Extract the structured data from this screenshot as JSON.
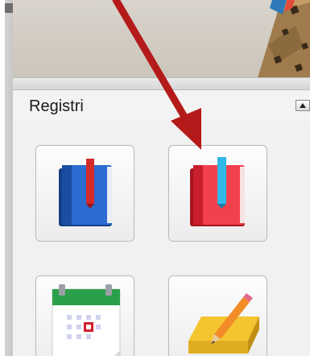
{
  "panel": {
    "title": "Registri"
  },
  "tiles": [
    {
      "icon": "blue-book-icon"
    },
    {
      "icon": "red-book-icon"
    },
    {
      "icon": "calendar-icon"
    },
    {
      "icon": "notepad-pencil-icon"
    }
  ],
  "colors": {
    "arrow": "#b51a1a",
    "blue_book": "#1f5bb8",
    "red_book": "#e8303b",
    "calendar_header": "#2aa04a",
    "notepad": "#f5c431"
  }
}
